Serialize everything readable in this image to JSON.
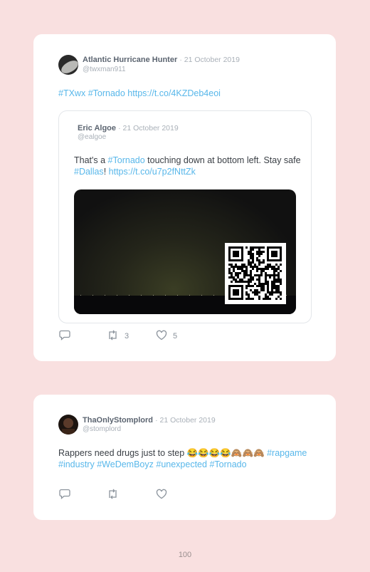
{
  "tweet1": {
    "name": "Atlantic Hurricane Hunter",
    "date": "· 21 October 2019",
    "handle": "@twxman911",
    "links": [
      "#TXwx",
      "#Tornado",
      "https://t.co/4KZDeb4eoi"
    ],
    "quote": {
      "name": "Eric Algoe",
      "date": "· 21 October 2019",
      "handle": "@ealgoe",
      "text_1": "That's a ",
      "tag_1": "#Tornado",
      "text_2": " touching down at bottom left. Stay safe ",
      "tag_2": "#Dallas",
      "text_3": "! ",
      "url": "https://t.co/u7p2fNttZk"
    },
    "retweets": "3",
    "likes": "5"
  },
  "tweet2": {
    "name": "ThaOnlyStomplord",
    "date": "· 21 October 2019",
    "handle": "@stomplord",
    "text": "Rappers need drugs just to step 😂😂😂😂🙈🙈🙈 ",
    "tags": [
      "#rapgame",
      "#industry",
      "#WeDemBoyz",
      "#unexpected",
      "#Tornado"
    ]
  },
  "page_number": "100",
  "colors": {
    "background": "#f9e0e0",
    "link": "#58b7ea",
    "card": "#ffffff"
  },
  "icons": [
    "reply-icon",
    "retweet-icon",
    "like-icon"
  ]
}
